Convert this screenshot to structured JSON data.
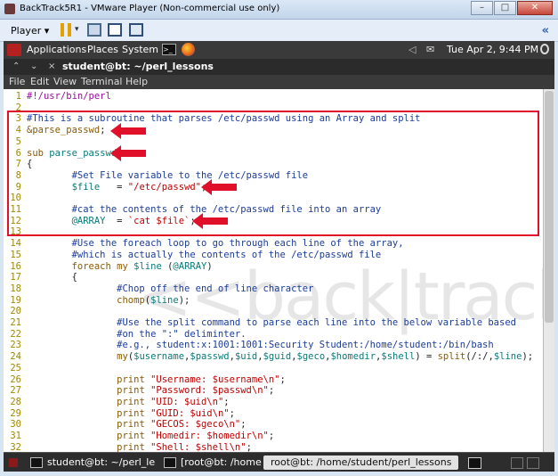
{
  "vmware": {
    "title": "BackTrack5R1 - VMware Player (Non-commercial use only)",
    "player_menu": "Player",
    "player_caret": "▾",
    "minimize": "–",
    "maximize": "□",
    "close": "✕",
    "expand": "«"
  },
  "gnome_panel": {
    "menus": [
      "Applications",
      "Places",
      "System"
    ],
    "terminal_glyph": ">_",
    "datetime": "Tue Apr  2,  9:44 PM",
    "speaker_glyph": "◁",
    "mail_glyph": "✉"
  },
  "terminal": {
    "close_glyph": "×",
    "minimize_glyph": "⌃",
    "down_glyph": "⌄",
    "title": "student@bt: ~/perl_lessons",
    "menu": [
      "File",
      "Edit",
      "View",
      "Terminal",
      "Help"
    ]
  },
  "watermark": "<<back|track 5",
  "code_lines": [
    {
      "n": "1",
      "segs": [
        {
          "t": "#!/usr/bin/perl",
          "c": "shebang"
        }
      ]
    },
    {
      "n": "2",
      "segs": []
    },
    {
      "n": "3",
      "segs": [
        {
          "t": "#This is a subroutine that parses /etc/passwd using an Array and split",
          "c": "comment"
        }
      ]
    },
    {
      "n": "4",
      "segs": [
        {
          "t": "&parse_passwd",
          "c": "keyword"
        },
        {
          "t": ";",
          "c": ""
        }
      ]
    },
    {
      "n": "5",
      "segs": []
    },
    {
      "n": "6",
      "segs": [
        {
          "t": "sub",
          "c": "keyword"
        },
        {
          "t": " ",
          "c": ""
        },
        {
          "t": "parse_passwd",
          "c": "var"
        }
      ]
    },
    {
      "n": "7",
      "segs": [
        {
          "t": "{",
          "c": ""
        }
      ]
    },
    {
      "n": "8",
      "segs": [
        {
          "t": "        #Set File variable to the /etc/passwd file",
          "c": "comment"
        }
      ]
    },
    {
      "n": "9",
      "segs": [
        {
          "t": "        ",
          "c": ""
        },
        {
          "t": "$file",
          "c": "var"
        },
        {
          "t": "   = ",
          "c": ""
        },
        {
          "t": "\"/etc/passwd\"",
          "c": "string"
        },
        {
          "t": ";",
          "c": ""
        }
      ]
    },
    {
      "n": "10",
      "segs": []
    },
    {
      "n": "11",
      "segs": [
        {
          "t": "        #cat the contents of the /etc/passwd file into an array",
          "c": "comment"
        }
      ]
    },
    {
      "n": "12",
      "segs": [
        {
          "t": "        ",
          "c": ""
        },
        {
          "t": "@ARRAY",
          "c": "var"
        },
        {
          "t": "  = ",
          "c": ""
        },
        {
          "t": "`cat $file`",
          "c": "bt"
        },
        {
          "t": ";",
          "c": ""
        }
      ]
    },
    {
      "n": "13",
      "segs": []
    },
    {
      "n": "14",
      "segs": [
        {
          "t": "        #Use the foreach loop to go through each line of the array,",
          "c": "comment"
        }
      ]
    },
    {
      "n": "15",
      "segs": [
        {
          "t": "        #which is actually the contents of the /etc/passwd file",
          "c": "comment"
        }
      ]
    },
    {
      "n": "16",
      "segs": [
        {
          "t": "        ",
          "c": ""
        },
        {
          "t": "foreach",
          "c": "keyword"
        },
        {
          "t": " ",
          "c": ""
        },
        {
          "t": "my",
          "c": "keyword"
        },
        {
          "t": " ",
          "c": ""
        },
        {
          "t": "$line",
          "c": "var"
        },
        {
          "t": " (",
          "c": ""
        },
        {
          "t": "@ARRAY",
          "c": "var"
        },
        {
          "t": ")",
          "c": ""
        }
      ]
    },
    {
      "n": "17",
      "segs": [
        {
          "t": "        {",
          "c": ""
        }
      ]
    },
    {
      "n": "18",
      "segs": [
        {
          "t": "                #Chop off the end of line character",
          "c": "comment"
        }
      ]
    },
    {
      "n": "19",
      "segs": [
        {
          "t": "                ",
          "c": ""
        },
        {
          "t": "chomp",
          "c": "keyword"
        },
        {
          "t": "(",
          "c": ""
        },
        {
          "t": "$line",
          "c": "var"
        },
        {
          "t": ");",
          "c": ""
        }
      ]
    },
    {
      "n": "20",
      "segs": []
    },
    {
      "n": "21",
      "segs": [
        {
          "t": "                #Use the split command to parse each line into the below variable based",
          "c": "comment"
        }
      ]
    },
    {
      "n": "22",
      "segs": [
        {
          "t": "                #on the \":\" deliminter.",
          "c": "comment"
        }
      ]
    },
    {
      "n": "23",
      "segs": [
        {
          "t": "                #e.g., student:x:1001:1001:Security Student:/home/student:/bin/bash",
          "c": "comment"
        }
      ]
    },
    {
      "n": "24",
      "segs": [
        {
          "t": "                ",
          "c": ""
        },
        {
          "t": "my",
          "c": "keyword"
        },
        {
          "t": "(",
          "c": ""
        },
        {
          "t": "$username",
          "c": "var"
        },
        {
          "t": ",",
          "c": ""
        },
        {
          "t": "$passwd",
          "c": "var"
        },
        {
          "t": ",",
          "c": ""
        },
        {
          "t": "$uid",
          "c": "var"
        },
        {
          "t": ",",
          "c": ""
        },
        {
          "t": "$guid",
          "c": "var"
        },
        {
          "t": ",",
          "c": ""
        },
        {
          "t": "$geco",
          "c": "var"
        },
        {
          "t": ",",
          "c": ""
        },
        {
          "t": "$homedir",
          "c": "var"
        },
        {
          "t": ",",
          "c": ""
        },
        {
          "t": "$shell",
          "c": "var"
        },
        {
          "t": ") = ",
          "c": ""
        },
        {
          "t": "split",
          "c": "keyword"
        },
        {
          "t": "(/:/,",
          "c": ""
        },
        {
          "t": "$line",
          "c": "var"
        },
        {
          "t": ");",
          "c": ""
        }
      ]
    },
    {
      "n": "25",
      "segs": []
    },
    {
      "n": "26",
      "segs": [
        {
          "t": "                ",
          "c": ""
        },
        {
          "t": "print",
          "c": "keyword"
        },
        {
          "t": " ",
          "c": ""
        },
        {
          "t": "\"Username: $username\\n\"",
          "c": "string"
        },
        {
          "t": ";",
          "c": ""
        }
      ]
    },
    {
      "n": "27",
      "segs": [
        {
          "t": "                ",
          "c": ""
        },
        {
          "t": "print",
          "c": "keyword"
        },
        {
          "t": " ",
          "c": ""
        },
        {
          "t": "\"Password: $passwd\\n\"",
          "c": "string"
        },
        {
          "t": ";",
          "c": ""
        }
      ]
    },
    {
      "n": "28",
      "segs": [
        {
          "t": "                ",
          "c": ""
        },
        {
          "t": "print",
          "c": "keyword"
        },
        {
          "t": " ",
          "c": ""
        },
        {
          "t": "\"UID: $uid\\n\"",
          "c": "string"
        },
        {
          "t": ";",
          "c": ""
        }
      ]
    },
    {
      "n": "29",
      "segs": [
        {
          "t": "                ",
          "c": ""
        },
        {
          "t": "print",
          "c": "keyword"
        },
        {
          "t": " ",
          "c": ""
        },
        {
          "t": "\"GUID: $uid\\n\"",
          "c": "string"
        },
        {
          "t": ";",
          "c": ""
        }
      ]
    },
    {
      "n": "30",
      "segs": [
        {
          "t": "                ",
          "c": ""
        },
        {
          "t": "print",
          "c": "keyword"
        },
        {
          "t": " ",
          "c": ""
        },
        {
          "t": "\"GECOS: $geco\\n\"",
          "c": "string"
        },
        {
          "t": ";",
          "c": ""
        }
      ]
    },
    {
      "n": "31",
      "segs": [
        {
          "t": "                ",
          "c": ""
        },
        {
          "t": "print",
          "c": "keyword"
        },
        {
          "t": " ",
          "c": ""
        },
        {
          "t": "\"Homedir: $homedir\\n\"",
          "c": "string"
        },
        {
          "t": ";",
          "c": ""
        }
      ]
    },
    {
      "n": "32",
      "segs": [
        {
          "t": "                ",
          "c": ""
        },
        {
          "t": "print",
          "c": "keyword"
        },
        {
          "t": " ",
          "c": ""
        },
        {
          "t": "\"Shell: $shell\\n\"",
          "c": "string"
        },
        {
          "t": ";",
          "c": ""
        }
      ]
    }
  ],
  "taskbar": {
    "tasks": [
      {
        "label": "student@bt: ~/perl_le...",
        "active": false
      },
      {
        "label": "[root@bt: /home/st",
        "active": false
      },
      {
        "label": "root@bt: /home/student/perl_lessons",
        "active": true
      }
    ]
  },
  "colors": {
    "highlight_box": "#e0102a",
    "arrow": "#e0102a"
  }
}
